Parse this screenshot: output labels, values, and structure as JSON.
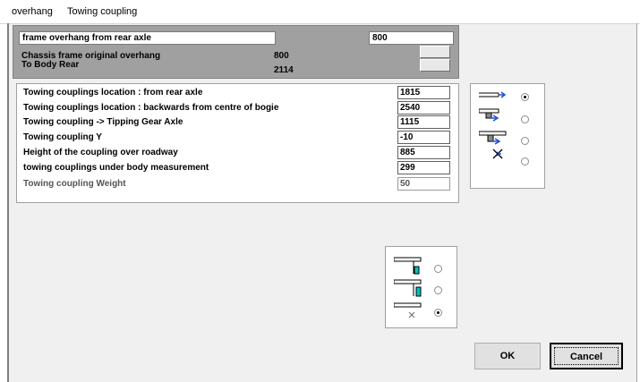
{
  "tabs": [
    {
      "label": "overhang"
    },
    {
      "label": "Towing coupling"
    }
  ],
  "overhang_group": {
    "frame_overhang_label": "frame overhang from rear axle",
    "frame_overhang_value": "800",
    "chassis_overhang_label": "Chassis frame original overhang",
    "chassis_overhang_value": "800",
    "to_body_rear_label": "To Body Rear",
    "to_body_rear_value": "2114"
  },
  "coupling_fields": [
    {
      "label": "Towing couplings location : from rear axle",
      "value": "1815",
      "enabled": true
    },
    {
      "label": "Towing couplings location : backwards from centre of bogie",
      "value": "2540",
      "enabled": true
    },
    {
      "label": "Towing coupling ->  Tipping Gear Axle",
      "value": "1115",
      "enabled": true
    },
    {
      "label": "Towing coupling Y",
      "value": "-10",
      "enabled": true
    },
    {
      "label": "Height of the coupling over roadway",
      "value": "885",
      "enabled": true
    },
    {
      "label": "towing couplings under body measurement",
      "value": "299",
      "enabled": true
    },
    {
      "label": "Towing coupling Weight",
      "value": "50",
      "enabled": false
    }
  ],
  "coupling_type_options": [
    {
      "icon": "coupling-at-frame-end-icon",
      "selected": true
    },
    {
      "icon": "coupling-under-frame-icon",
      "selected": false
    },
    {
      "icon": "coupling-under-frame-offset-icon",
      "selected": false
    },
    {
      "icon": "no-coupling-icon",
      "selected": false
    }
  ],
  "frame_end_options": [
    {
      "icon": "frame-end-drop-icon",
      "selected": false
    },
    {
      "icon": "frame-end-drop-inner-icon",
      "selected": false
    },
    {
      "icon": "frame-end-none-icon",
      "selected": true
    }
  ],
  "buttons": {
    "ok": "OK",
    "cancel": "Cancel"
  },
  "colors": {
    "accent_blue": "#1f4fd1",
    "cyan": "#00c0c0",
    "group_gray": "#a0a0a0"
  }
}
